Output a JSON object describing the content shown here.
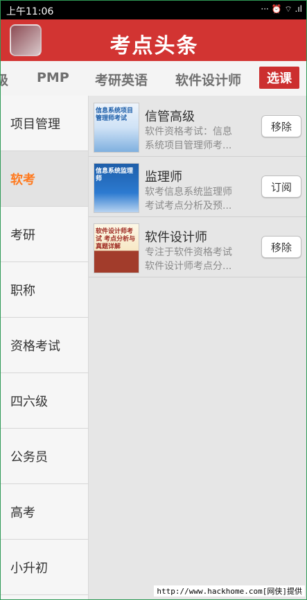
{
  "statusbar": {
    "time": "上午11:06",
    "icons": "··· ⏰ ⌔ .ıl"
  },
  "header": {
    "title": "考点头条"
  },
  "tabs": [
    {
      "label": "级"
    },
    {
      "label": "PMP"
    },
    {
      "label": "考研英语"
    },
    {
      "label": "软件设计师"
    }
  ],
  "choose_button": "选课",
  "sidebar": {
    "items": [
      {
        "label": "项目管理"
      },
      {
        "label": "软考"
      },
      {
        "label": "考研"
      },
      {
        "label": "职称"
      },
      {
        "label": "资格考试"
      },
      {
        "label": "四六级"
      },
      {
        "label": "公务员"
      },
      {
        "label": "高考"
      },
      {
        "label": "小升初"
      }
    ],
    "active_index": 1
  },
  "courses": [
    {
      "title": "信管高级",
      "desc_line1": "软件资格考试：信息",
      "desc_line2": "系统项目管理师考...",
      "action": "移除",
      "cover_text": "信息系统项目管理师考试"
    },
    {
      "title": "监理师",
      "desc_line1": "软考信息系统监理师",
      "desc_line2": "考试考点分析及预...",
      "action": "订阅",
      "cover_text": "信息系统监理师"
    },
    {
      "title": "软件设计师",
      "desc_line1": "专注于软件资格考试",
      "desc_line2": "软件设计师考点分...",
      "action": "移除",
      "cover_text": "软件设计师考试 考点分析与真题详解"
    }
  ],
  "watermark": "http://www.hackhome.com[网侠]提供",
  "colors": {
    "header_red": "#d23432",
    "active_orange": "#ff7a1f"
  }
}
